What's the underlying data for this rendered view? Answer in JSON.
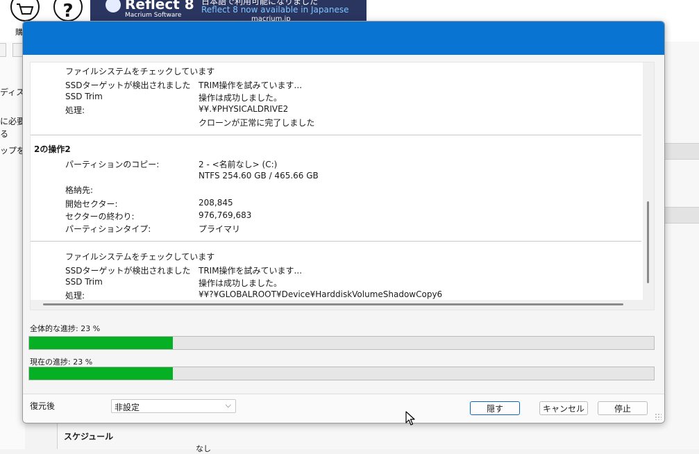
{
  "background": {
    "toolbar_label": "購",
    "banner": {
      "brand": "Reflect 8",
      "sub": "Macrium Software",
      "news": "Reflect 8 now available in Japanese",
      "top_text": "日本語で利用可能になりました",
      "bottom_text": "macrium.jp"
    },
    "left_text": [
      "ディス",
      "に必要",
      "る",
      "ップを"
    ],
    "schedule_label": "スケジュール",
    "schedule_value": "なし"
  },
  "dialog": {
    "log": {
      "block1": [
        {
          "full": "ファイルシステムをチェックしています"
        },
        {
          "k": "SSDターゲットが検出されました",
          "v": "TRIM操作を試みています..."
        },
        {
          "k": "SSD Trim",
          "v": "操作は成功しました。"
        },
        {
          "k": "処理:",
          "v": "¥¥.¥PHYSICALDRIVE2"
        },
        {
          "k": "",
          "v": "クローンが正常に完了しました"
        }
      ],
      "op2_heading": "2の操作2",
      "block2": [
        {
          "k": "パーティションのコピー:",
          "v": "2 - <名前なし> (C:)"
        },
        {
          "k": "",
          "v": "NTFS 254.60 GB / 465.66 GB"
        },
        {
          "k": "格納先:",
          "v": ""
        },
        {
          "k": "開始セクター:",
          "v": "208,845"
        },
        {
          "k": "セクターの終わり:",
          "v": "976,769,683"
        },
        {
          "k": "パーティションタイプ:",
          "v": "プライマリ"
        }
      ],
      "block3": [
        {
          "full": "ファイルシステムをチェックしています"
        },
        {
          "k": "SSDターゲットが検出されました",
          "v": "TRIM操作を試みています..."
        },
        {
          "k": "SSD Trim",
          "v": "操作は成功しました。"
        },
        {
          "k": "処理:",
          "v": "¥¥?¥GLOBALROOT¥Device¥HarddiskVolumeShadowCopy6"
        }
      ]
    },
    "overall_progress": {
      "label": "全体的な進捗: 23 %",
      "percent": 23
    },
    "current_progress": {
      "label": "現在の進捗: 23 %",
      "percent": 23
    },
    "after": {
      "label": "復元後",
      "selected": "非設定"
    },
    "buttons": {
      "hide": "隠す",
      "cancel": "キャンセル",
      "stop": "停止"
    },
    "colors": {
      "titlebar": "#0a74d2",
      "progress": "#06b025"
    }
  }
}
